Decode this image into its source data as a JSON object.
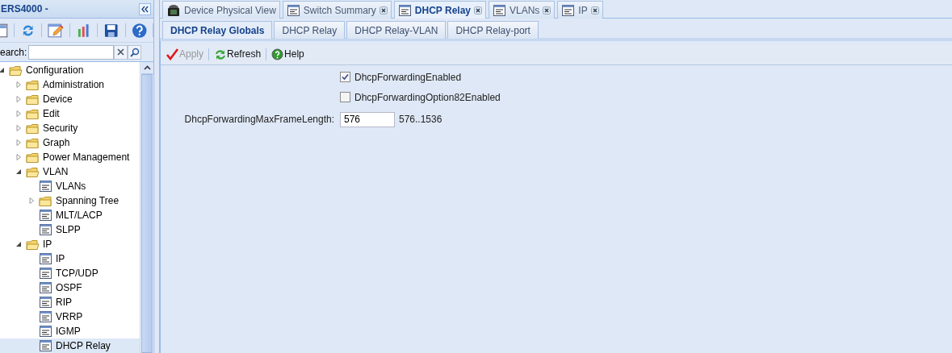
{
  "sidebar": {
    "title": "ERS4000 -",
    "search": {
      "label": "earch:"
    },
    "tree": [
      {
        "label": "Configuration",
        "kind": "folder",
        "expanded": true,
        "selected": false,
        "children": [
          {
            "label": "Administration",
            "kind": "folder",
            "expanded": false,
            "selected": false
          },
          {
            "label": "Device",
            "kind": "folder",
            "expanded": false,
            "selected": false
          },
          {
            "label": "Edit",
            "kind": "folder",
            "expanded": false,
            "selected": false
          },
          {
            "label": "Security",
            "kind": "folder",
            "expanded": false,
            "selected": false
          },
          {
            "label": "Graph",
            "kind": "folder",
            "expanded": false,
            "selected": false
          },
          {
            "label": "Power Management",
            "kind": "folder",
            "expanded": false,
            "selected": false
          },
          {
            "label": "VLAN",
            "kind": "folder",
            "expanded": true,
            "selected": false,
            "children": [
              {
                "label": "VLANs",
                "kind": "leaf",
                "selected": false
              },
              {
                "label": "Spanning Tree",
                "kind": "folder",
                "expanded": false,
                "selected": false
              },
              {
                "label": "MLT/LACP",
                "kind": "leaf",
                "selected": false
              },
              {
                "label": "SLPP",
                "kind": "leaf",
                "selected": false
              }
            ]
          },
          {
            "label": "IP",
            "kind": "folder",
            "expanded": true,
            "selected": false,
            "children": [
              {
                "label": "IP",
                "kind": "leaf",
                "selected": false
              },
              {
                "label": "TCP/UDP",
                "kind": "leaf",
                "selected": false
              },
              {
                "label": "OSPF",
                "kind": "leaf",
                "selected": false
              },
              {
                "label": "RIP",
                "kind": "leaf",
                "selected": false
              },
              {
                "label": "VRRP",
                "kind": "leaf",
                "selected": false
              },
              {
                "label": "IGMP",
                "kind": "leaf",
                "selected": false
              },
              {
                "label": "DHCP Relay",
                "kind": "leaf",
                "selected": true
              }
            ]
          }
        ]
      }
    ]
  },
  "tabs": [
    {
      "label": "Device Physical View",
      "kind": "device",
      "closable": false,
      "selected": false
    },
    {
      "label": "Switch Summary",
      "kind": "page",
      "closable": true,
      "selected": false
    },
    {
      "label": "DHCP Relay",
      "kind": "page",
      "closable": true,
      "selected": true
    },
    {
      "label": "VLANs",
      "kind": "page",
      "closable": true,
      "selected": false
    },
    {
      "label": "IP",
      "kind": "page",
      "closable": true,
      "selected": false
    }
  ],
  "subtabs": [
    {
      "label": "DHCP Relay Globals",
      "selected": true
    },
    {
      "label": "DHCP Relay",
      "selected": false
    },
    {
      "label": "DHCP Relay-VLAN",
      "selected": false
    },
    {
      "label": "DHCP Relay-port",
      "selected": false
    }
  ],
  "toolbar": [
    {
      "label": "Apply",
      "kind": "apply",
      "disabled": true
    },
    {
      "label": "Refresh",
      "kind": "refresh",
      "disabled": false
    },
    {
      "label": "Help",
      "kind": "help",
      "disabled": false
    }
  ],
  "form": [
    {
      "kind": "checkbox",
      "label": "DhcpForwardingEnabled",
      "checked": true
    },
    {
      "kind": "checkbox",
      "label": "DhcpForwardingOption82Enabled",
      "checked": false
    },
    {
      "kind": "text",
      "label": "DhcpForwardingMaxFrameLength:",
      "value": "576",
      "range": "576..1536"
    }
  ]
}
